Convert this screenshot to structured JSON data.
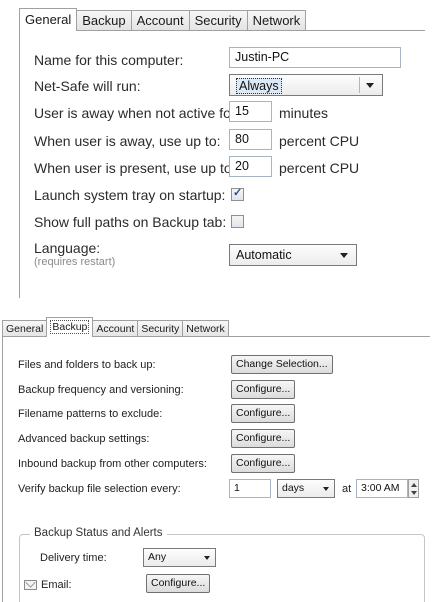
{
  "general_panel": {
    "tabs": [
      "General",
      "Backup",
      "Account",
      "Security",
      "Network"
    ],
    "active_tab": "General",
    "fields": {
      "computer_name_label": "Name for this computer:",
      "computer_name_value": "Justin-PC",
      "run_label": "Net-Safe will run:",
      "run_value": "Always",
      "away_inactive_label": "User is away when not active for:",
      "away_inactive_value": "15",
      "away_inactive_unit": "minutes",
      "away_cpu_label": "When user is away, use up to:",
      "away_cpu_value": "80",
      "away_cpu_unit": "percent CPU",
      "present_cpu_label": "When user is present, use up to:",
      "present_cpu_value": "20",
      "present_cpu_unit": "percent CPU",
      "launch_tray_label": "Launch system tray on startup:",
      "launch_tray_checked": true,
      "full_paths_label": "Show full paths on Backup tab:",
      "full_paths_checked": false,
      "language_label": "Language:",
      "language_note": "(requires restart)",
      "language_value": "Automatic"
    }
  },
  "backup_panel": {
    "tabs": [
      "General",
      "Backup",
      "Account",
      "Security",
      "Network"
    ],
    "active_tab": "Backup",
    "rows": {
      "files_label": "Files and folders to back up:",
      "files_button": "Change Selection...",
      "frequency_label": "Backup frequency and versioning:",
      "frequency_button": "Configure...",
      "patterns_label": "Filename patterns to exclude:",
      "patterns_button": "Configure...",
      "advanced_label": "Advanced backup settings:",
      "advanced_button": "Configure...",
      "inbound_label": "Inbound backup from other computers:",
      "inbound_button": "Configure...",
      "verify_label": "Verify backup file selection every:",
      "verify_value": "1",
      "verify_unit": "days",
      "verify_at": "at",
      "verify_time": "3:00 AM"
    },
    "status_group": {
      "title": "Backup Status and Alerts",
      "delivery_label": "Delivery time:",
      "delivery_value": "Any",
      "email_label": "Email:",
      "email_button": "Configure..."
    }
  },
  "icons": [
    "checkbox-checked-icon",
    "checkbox-unchecked-icon",
    "dropdown-arrow-icon",
    "spinner-up-icon",
    "spinner-down-icon",
    "envelope-icon"
  ]
}
